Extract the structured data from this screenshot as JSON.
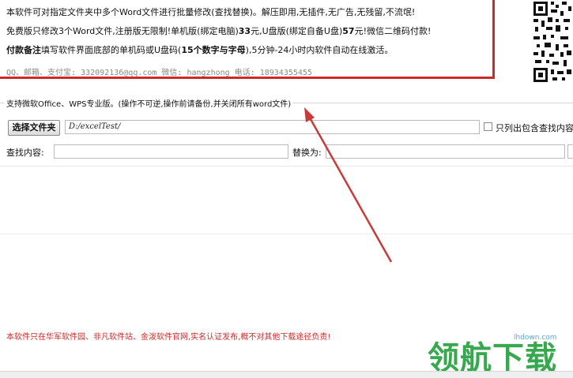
{
  "notice": {
    "line1": "本软件可对指定文件夹中多个Word文件进行批量修改(查找替换)。解压即用,无插件,无广告,无残留,不流氓!",
    "line2_prefix": "免费版只修改3个Word文件,注册版无限制!单机版(绑定电脑)",
    "line2_price1": "33",
    "line2_mid": "元,U盘版(绑定自备U盘)",
    "line2_price2": "57",
    "line2_suffix": "元!微信二维码付款!",
    "line3_label": "付款备注",
    "line3_text": "填写软件界面底部的单机码或U盘码(",
    "line3_bold": "15个数字与字母",
    "line3_suffix": "),5分钟-24小时内软件自动在线激活。",
    "contact": "QQ、邮箱、支付宝: 332092136@qq.com    微信: hangzhong    电话: 18934355455"
  },
  "group_title": "支持微软Office、WPS专业版。(操作不可逆,操作前请备份,并关闭所有word文件)",
  "folder": {
    "button_label": "选择文件夹",
    "path_value": "D:/excelTest/",
    "checkbox_label": "只列出包含查找内容"
  },
  "find": {
    "label": "查找内容:",
    "value": ""
  },
  "replace": {
    "label": "替换为:",
    "value": ""
  },
  "footer_note": "本软件只在华军软件园、非凡软件站、金泼软件官网,实名认证发布,概不对其他下载途径负责!",
  "watermark": {
    "url": "lhdown.com",
    "text": "领航下载"
  },
  "colors": {
    "accent_red": "#cc2a2a",
    "watermark_green": "#38a84e"
  }
}
